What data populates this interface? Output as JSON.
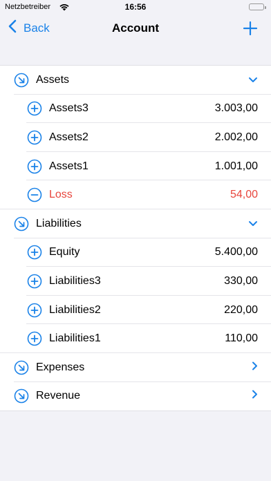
{
  "status": {
    "carrier": "Netzbetreiber",
    "time": "16:56"
  },
  "nav": {
    "back_label": "Back",
    "title": "Account"
  },
  "colors": {
    "accent": "#1a82e8",
    "negative": "#e8453c",
    "background": "#f2f2f7"
  },
  "groups": [
    {
      "label": "Assets",
      "expanded": true,
      "icon": "arrow-down-right-circle-icon",
      "children": [
        {
          "label": "Assets3",
          "amount": "3.003,00",
          "icon": "plus-circle-icon"
        },
        {
          "label": "Assets2",
          "amount": "2.002,00",
          "icon": "plus-circle-icon"
        },
        {
          "label": "Assets1",
          "amount": "1.001,00",
          "icon": "plus-circle-icon"
        },
        {
          "label": "Loss",
          "amount": "54,00",
          "icon": "minus-circle-icon",
          "negative": true
        }
      ]
    },
    {
      "label": "Liabilities",
      "expanded": true,
      "icon": "arrow-down-right-circle-icon",
      "children": [
        {
          "label": "Equity",
          "amount": "5.400,00",
          "icon": "plus-circle-icon"
        },
        {
          "label": "Liabilities3",
          "amount": "330,00",
          "icon": "plus-circle-icon"
        },
        {
          "label": "Liabilities2",
          "amount": "220,00",
          "icon": "plus-circle-icon"
        },
        {
          "label": "Liabilities1",
          "amount": "110,00",
          "icon": "plus-circle-icon"
        }
      ]
    },
    {
      "label": "Expenses",
      "expanded": false,
      "icon": "arrow-down-right-circle-icon",
      "children": []
    },
    {
      "label": "Revenue",
      "expanded": false,
      "icon": "arrow-down-right-circle-icon",
      "children": []
    }
  ]
}
